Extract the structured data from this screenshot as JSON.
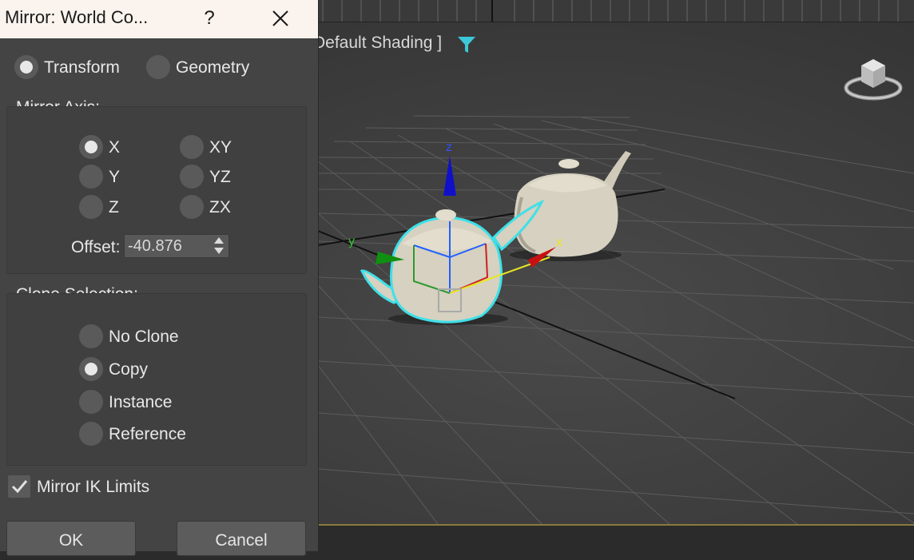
{
  "dialog": {
    "title": "Mirror: World Co...",
    "help_label": "?",
    "mode": {
      "transform_label": "Transform",
      "geometry_label": "Geometry",
      "selected": "Transform"
    },
    "mirror_axis": {
      "group_label": "Mirror Axis:",
      "options": [
        "X",
        "Y",
        "Z",
        "XY",
        "YZ",
        "ZX"
      ],
      "selected": "X",
      "offset_label": "Offset:",
      "offset_value": "-40.876"
    },
    "clone_selection": {
      "group_label": "Clone Selection:",
      "options": [
        "No Clone",
        "Copy",
        "Instance",
        "Reference"
      ],
      "selected": "Copy"
    },
    "mirror_ik_limits": {
      "label": "Mirror IK Limits",
      "checked": true
    },
    "ok_label": "OK",
    "cancel_label": "Cancel"
  },
  "viewport": {
    "shading_label": "Default Shading ]",
    "gizmo_axes": {
      "x": "x",
      "y": "y",
      "z": "z"
    },
    "selection_color": "#3fe0e8",
    "grid_color": "#5a5a5a"
  }
}
